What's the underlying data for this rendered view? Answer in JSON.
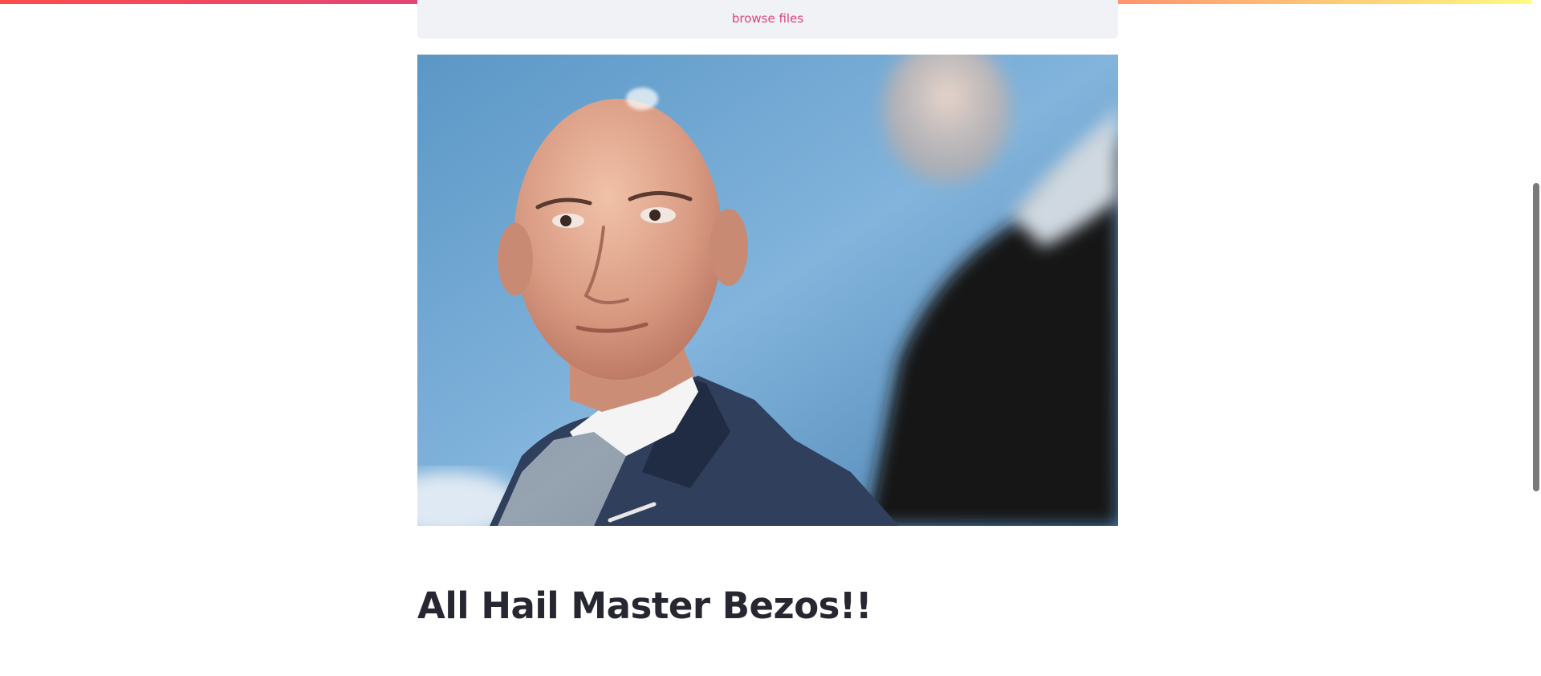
{
  "uploader": {
    "browse_label": "browse files"
  },
  "image": {
    "subject": "portrait photo of a bald man in a suit looking to the side"
  },
  "content": {
    "title": "All Hail Master Bezos!!"
  },
  "colors": {
    "accent": "#e0457a",
    "title_text": "#262730",
    "uploader_bg": "#f0f2f6"
  }
}
